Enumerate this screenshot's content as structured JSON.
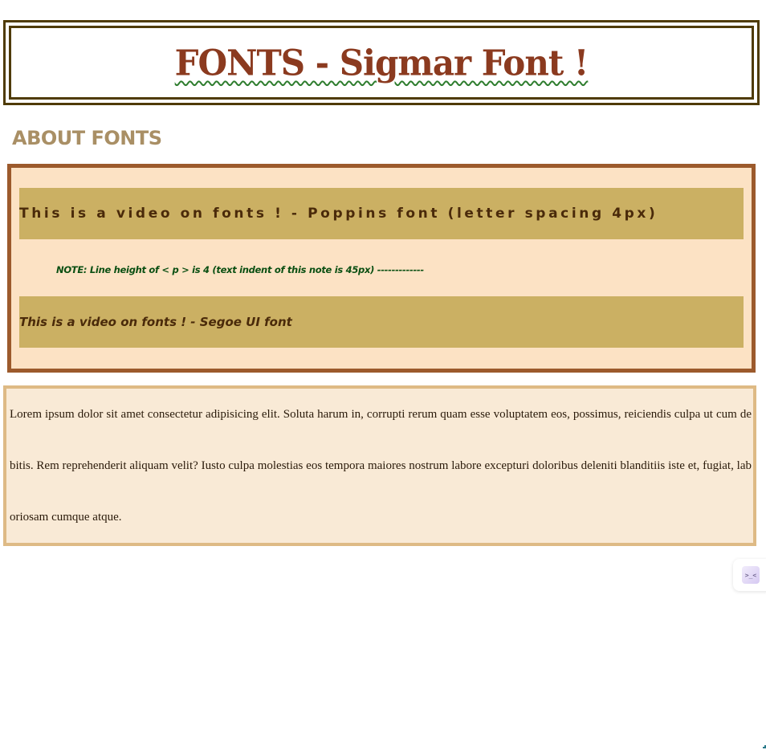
{
  "header": {
    "title": "FONTS - Sigmar Font !"
  },
  "about": {
    "heading": "ABOUT FONTS"
  },
  "video_box": {
    "poppins_line": "This is a video on fonts ! - Poppins font (letter spacing 4px)",
    "note": "NOTE: Line height of < p > is 4 (text indent of this note is 45px) -------------",
    "segoe_line": "This is a video on fonts ! - Segoe UI font"
  },
  "lorem": {
    "text": "Lorem ipsum dolor sit amet consectetur adipisicing elit. Soluta harum in, corrupti rerum quam esse voluptatem eos, possimus, reiciendis culpa ut cum debitis. Rem reprehenderit aliquam velit? Iusto culpa molestias eos tempora maiores nostrum labore excepturi doloribus deleniti blanditiis iste et, fugiat, laboriosam cumque atque."
  },
  "widget": {
    "icon_name": "extension-icon",
    "glyph": ">_<"
  },
  "colors": {
    "title_text": "#8b3a1f",
    "title_border": "#4f3b06",
    "heading": "#a98f65",
    "video_bg": "#fce2c4",
    "video_border": "#9c5a2c",
    "band_bg": "#cbb063",
    "note_text": "#0a4f12",
    "lorem_bg": "#f9ead6",
    "lorem_border": "#deba85"
  }
}
